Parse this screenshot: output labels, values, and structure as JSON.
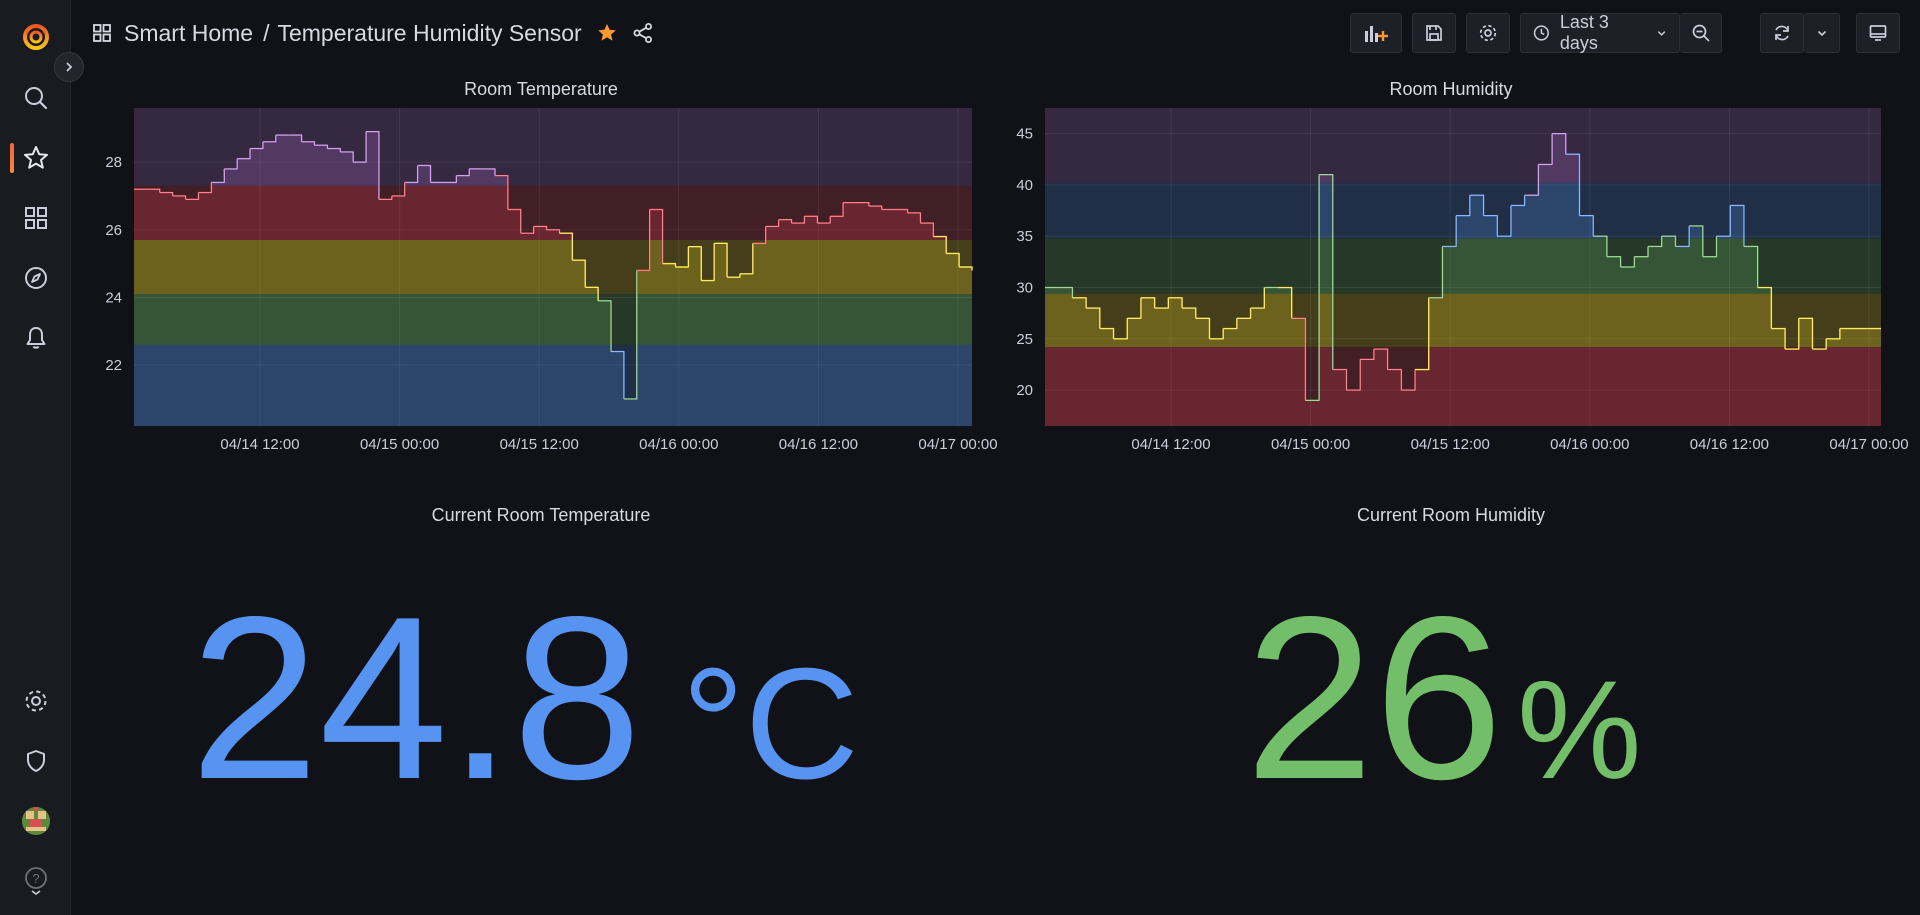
{
  "breadcrumb": {
    "folder": "Smart Home",
    "separator": "/",
    "dashboard": "Temperature Humidity Sensor"
  },
  "toolbar": {
    "time_range": "Last 3 days"
  },
  "sidebar": {
    "items": [
      {
        "name": "logo-icon"
      },
      {
        "name": "search-icon"
      },
      {
        "name": "starred-icon"
      },
      {
        "name": "dashboards-icon"
      },
      {
        "name": "explore-icon"
      },
      {
        "name": "alerting-icon"
      },
      {
        "name": "configuration-icon"
      },
      {
        "name": "server-admin-icon"
      },
      {
        "name": "avatar"
      },
      {
        "name": "help-icon"
      }
    ]
  },
  "colors": {
    "bg": "#111217",
    "threshold_blue": "#5794f2",
    "threshold_green": "#73bf69",
    "threshold_yellow": "#fade2a",
    "threshold_red": "#f2495c",
    "threshold_purple": "#b877d9",
    "accent_orange": "#ff9830"
  },
  "panels": {
    "temperature_chart": {
      "title": "Room Temperature"
    },
    "humidity_chart": {
      "title": "Room Humidity"
    },
    "current_temperature": {
      "title": "Current Room Temperature",
      "value": "24.8",
      "unit": "°C",
      "color": "#5794f2"
    },
    "current_humidity": {
      "title": "Current Room Humidity",
      "value": "26",
      "unit": "%",
      "color": "#73bf69"
    }
  },
  "chart_data": [
    {
      "type": "line",
      "title": "Room Temperature",
      "x_ticks": [
        "04/14 12:00",
        "04/15 00:00",
        "04/15 12:00",
        "04/16 00:00",
        "04/16 12:00",
        "04/17 00:00"
      ],
      "y_ticks": [
        22,
        24,
        26,
        28
      ],
      "ylim": [
        20.2,
        29.6
      ],
      "grid": true,
      "thresholds": [
        {
          "from": 20.2,
          "to": 22.6,
          "color": "#5794f2"
        },
        {
          "from": 22.6,
          "to": 24.1,
          "color": "#73bf69"
        },
        {
          "from": 24.1,
          "to": 25.7,
          "color": "#fade2a"
        },
        {
          "from": 25.7,
          "to": 27.3,
          "color": "#f2495c"
        },
        {
          "from": 27.3,
          "to": 29.6,
          "color": "#b877d9"
        }
      ],
      "x_hours": [
        0,
        1,
        2,
        3,
        4,
        5,
        6,
        7,
        8,
        9,
        10,
        11,
        12,
        13,
        14,
        15,
        16,
        17,
        18,
        19,
        20,
        21,
        22,
        23,
        24,
        25,
        26,
        27,
        28,
        29,
        30,
        31,
        32,
        33,
        34,
        35,
        36,
        37,
        38,
        39,
        40,
        41,
        42,
        43,
        44,
        45,
        46,
        47,
        48,
        49,
        50,
        51,
        52,
        53,
        54,
        55,
        56,
        57,
        58,
        59,
        60,
        61,
        62,
        63,
        64,
        65,
        66,
        67,
        68,
        69,
        70,
        71,
        72
      ],
      "values": [
        27.2,
        27.2,
        27.1,
        27.0,
        26.9,
        27.1,
        27.4,
        27.8,
        28.1,
        28.4,
        28.6,
        28.8,
        28.8,
        28.6,
        28.5,
        28.4,
        28.3,
        28.0,
        28.9,
        26.9,
        27.0,
        27.4,
        27.9,
        27.4,
        27.4,
        27.6,
        27.8,
        27.8,
        27.6,
        26.6,
        25.9,
        26.1,
        26.0,
        25.9,
        25.1,
        24.3,
        23.9,
        22.4,
        21.0,
        24.8,
        26.6,
        25.0,
        24.9,
        25.5,
        24.5,
        25.6,
        24.6,
        24.7,
        25.6,
        26.1,
        26.3,
        26.2,
        26.4,
        26.2,
        26.4,
        26.8,
        26.8,
        26.7,
        26.6,
        26.6,
        26.5,
        26.2,
        25.8,
        25.3,
        24.9,
        24.8
      ]
    },
    {
      "type": "line",
      "title": "Room Humidity",
      "x_ticks": [
        "04/14 12:00",
        "04/15 00:00",
        "04/15 12:00",
        "04/16 00:00",
        "04/16 12:00",
        "04/17 00:00"
      ],
      "y_ticks": [
        20,
        25,
        30,
        35,
        40,
        45
      ],
      "ylim": [
        16.5,
        47.5
      ],
      "grid": true,
      "thresholds": [
        {
          "from": 16.5,
          "to": 24.2,
          "color": "#f2495c"
        },
        {
          "from": 24.2,
          "to": 29.4,
          "color": "#fade2a"
        },
        {
          "from": 29.4,
          "to": 34.8,
          "color": "#73bf69"
        },
        {
          "from": 34.8,
          "to": 40.2,
          "color": "#5794f2"
        },
        {
          "from": 40.2,
          "to": 47.5,
          "color": "#b877d9"
        }
      ],
      "x_hours": [
        0,
        1,
        2,
        3,
        4,
        5,
        6,
        7,
        8,
        9,
        10,
        11,
        12,
        13,
        14,
        15,
        16,
        17,
        18,
        19,
        20,
        21,
        22,
        23,
        24,
        25,
        26,
        27,
        28,
        29,
        30,
        31,
        32,
        33,
        34,
        35,
        36,
        37,
        38,
        39,
        40,
        41,
        42,
        43,
        44,
        45,
        46,
        47,
        48,
        49,
        50,
        51,
        52,
        53,
        54,
        55,
        56,
        57,
        58,
        59,
        60,
        61,
        62,
        63,
        64,
        65,
        66,
        67,
        68,
        69,
        70,
        71,
        72
      ],
      "values": [
        30,
        30,
        29,
        28,
        26,
        25,
        27,
        29,
        28,
        29,
        28,
        27,
        25,
        26,
        27,
        28,
        30,
        30,
        27,
        19,
        41,
        22,
        20,
        23,
        24,
        22,
        20,
        22,
        29,
        34,
        37,
        39,
        37,
        35,
        38,
        39,
        42,
        45,
        43,
        37,
        35,
        33,
        32,
        33,
        34,
        35,
        34,
        36,
        33,
        35,
        38,
        34,
        30,
        26,
        24,
        27,
        24,
        25,
        26,
        26,
        26,
        26
      ]
    }
  ]
}
